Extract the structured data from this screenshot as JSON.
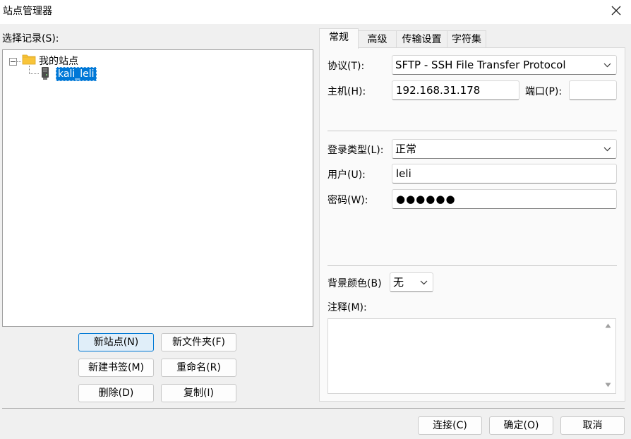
{
  "window": {
    "title": "站点管理器"
  },
  "left": {
    "select_label": "选择记录(S):",
    "tree": {
      "root_label": "我的站点",
      "site_label": "kali_leli"
    },
    "buttons": {
      "new_site": "新站点(N)",
      "new_folder": "新文件夹(F)",
      "new_bookmark": "新建书签(M)",
      "rename": "重命名(R)",
      "delete": "删除(D)",
      "copy": "复制(I)"
    }
  },
  "tabs": [
    {
      "label": "常规",
      "active": true
    },
    {
      "label": "高级",
      "active": false
    },
    {
      "label": "传输设置",
      "active": false
    },
    {
      "label": "字符集",
      "active": false
    }
  ],
  "general": {
    "protocol_label": "协议(T):",
    "protocol_value": "SFTP - SSH File Transfer Protocol",
    "host_label": "主机(H):",
    "host_value": "192.168.31.178",
    "port_label": "端口(P):",
    "port_value": "",
    "logon_type_label": "登录类型(L):",
    "logon_type_value": "正常",
    "user_label": "用户(U):",
    "user_value": "leli",
    "password_label": "密码(W):",
    "password_value": "●●●●●●",
    "bgcolor_label": "背景颜色(B)",
    "bgcolor_value": "无",
    "comments_label": "注释(M):",
    "comments_value": ""
  },
  "footer": {
    "connect": "连接(C)",
    "ok": "确定(O)",
    "cancel": "取消"
  },
  "colors": {
    "selection": "#0078d7",
    "folder": "#f8c43a",
    "primary_border": "#0078d4"
  }
}
